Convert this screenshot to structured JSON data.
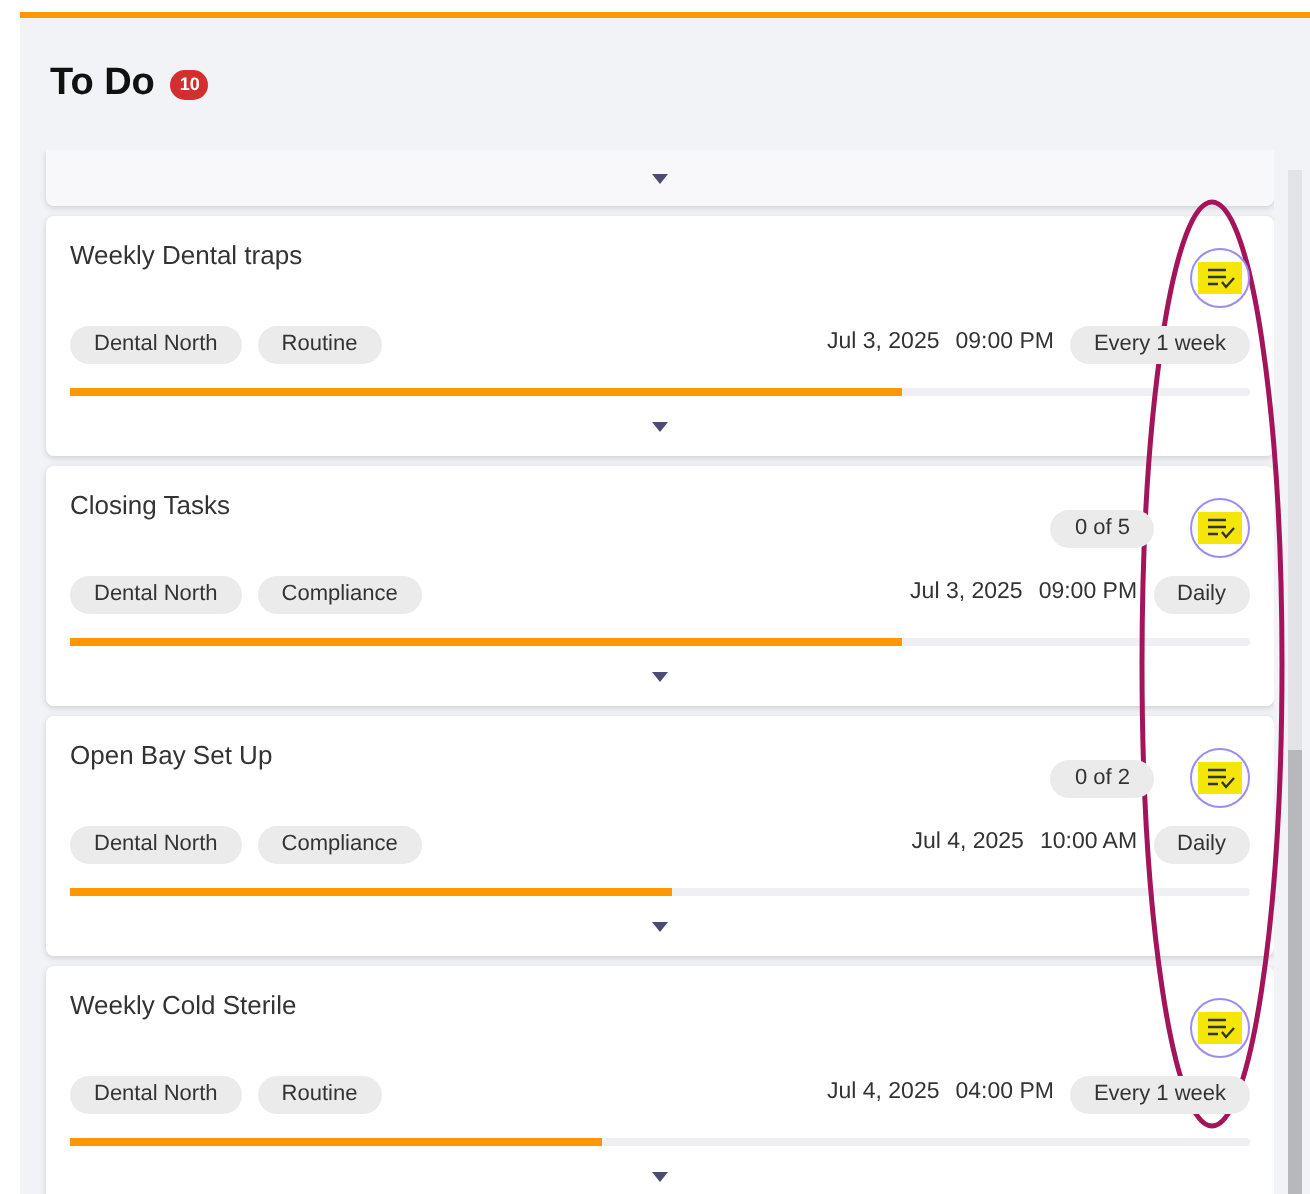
{
  "header": {
    "title": "To Do",
    "badge": "10"
  },
  "tasks": [
    {
      "title": "Weekly Dental traps",
      "tags": [
        "Dental North",
        "Routine"
      ],
      "date": "Jul 3, 2025",
      "time": "09:00 PM",
      "frequency": "Every 1 week",
      "level": 0.705
    },
    {
      "title": "Closing Tasks",
      "counter": "0 of 5",
      "tags": [
        "Dental North",
        "Compliance"
      ],
      "date": "Jul 3, 2025",
      "time": "09:00 PM",
      "frequency": "Daily",
      "level": 0.705
    },
    {
      "title": "Open Bay Set Up",
      "counter": "0 of 2",
      "tags": [
        "Dental North",
        "Compliance"
      ],
      "date": "Jul 4, 2025",
      "time": "10:00 AM",
      "frequency": "Daily",
      "level": 0.51
    },
    {
      "title": "Weekly Cold Sterile",
      "tags": [
        "Dental North",
        "Routine"
      ],
      "date": "Jul 4, 2025",
      "time": "04:00 PM",
      "frequency": "Every 1 week",
      "level": 0.45
    }
  ]
}
